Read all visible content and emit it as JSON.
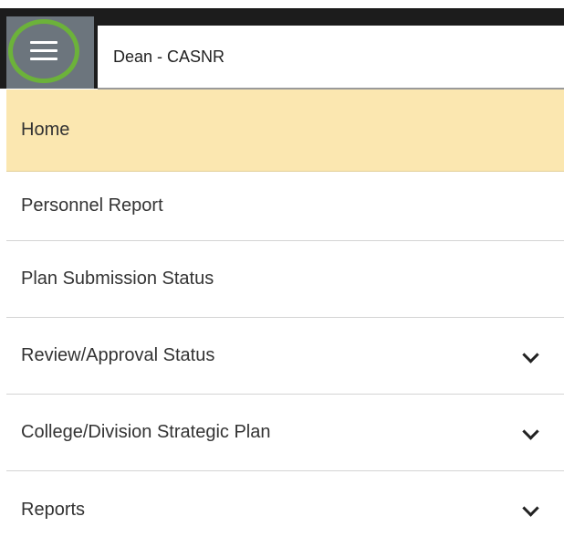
{
  "header": {
    "menu_icon": "hamburger-menu-icon",
    "role_label": "Dean - CASNR",
    "highlight_color": "#6cb23a",
    "menu_button_color": "#6c757d"
  },
  "nav": {
    "active_color": "#fbe7b0",
    "items": [
      {
        "label": "Home",
        "expandable": false,
        "active": true
      },
      {
        "label": "Personnel Report",
        "expandable": false,
        "active": false
      },
      {
        "label": "Plan Submission Status",
        "expandable": false,
        "active": false
      },
      {
        "label": "Review/Approval Status",
        "expandable": true,
        "icon": "chevron-down-icon",
        "active": false
      },
      {
        "label": "College/Division Strategic Plan",
        "expandable": true,
        "icon": "chevron-down-icon",
        "active": false
      },
      {
        "label": "Reports",
        "expandable": true,
        "icon": "chevron-down-icon",
        "active": false
      }
    ]
  }
}
